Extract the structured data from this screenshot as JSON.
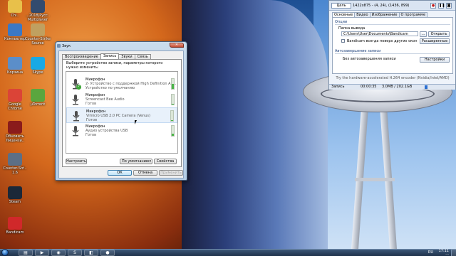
{
  "desktop": {
    "icons": [
      {
        "label": "Chi..",
        "icon": "folder-icon",
        "color": "#e8c04a"
      },
      {
        "label": "...2018|Русс.. Multiplayer",
        "icon": "game-icon",
        "color": "#334b6e"
      },
      {
        "label": "Компьютер",
        "icon": "computer-icon",
        "color": "#3b78c4"
      },
      {
        "label": "Counter-Strike Source",
        "icon": "cs-icon",
        "color": "#c0a060"
      },
      {
        "label": "Корзина",
        "icon": "recycle-bin-icon",
        "color": "#5b8ec9"
      },
      {
        "label": "Skype",
        "icon": "skype-icon",
        "color": "#19a9e5"
      },
      {
        "label": "Google Chrome",
        "icon": "chrome-icon",
        "color": "#db4437"
      },
      {
        "label": "µTorrent",
        "icon": "utorrent-icon",
        "color": "#5aa63e"
      },
      {
        "label": "Обновить Лицензи..",
        "icon": "update-icon",
        "color": "#8a1b1b"
      },
      {
        "label": "Counter-Stri.. 1.6",
        "icon": "cs16-icon",
        "color": "#5c6f86"
      },
      {
        "label": "Steam",
        "icon": "steam-icon",
        "color": "#1b2838"
      },
      {
        "label": "Bandicam",
        "icon": "bandicam-icon",
        "color": "#d0282a"
      }
    ]
  },
  "sound_dialog": {
    "title": "Звук",
    "close": "✕",
    "tabs": [
      "Воспроизведение",
      "Запись",
      "Звуки",
      "Связь"
    ],
    "active_tab": 1,
    "instruction": "Выберите устройство записи, параметры которого нужно изменить:",
    "devices": [
      {
        "name": "Микрофон",
        "desc": "2- Устройство с поддержкой High Definition Au...",
        "state": "Устройство по умолчанию",
        "level": 0.5,
        "default": true,
        "selected": false
      },
      {
        "name": "Микрофон",
        "desc": "Screencast Bee Audio",
        "state": "Готов",
        "level": 0.1,
        "default": false,
        "selected": false
      },
      {
        "name": "Микрофон",
        "desc": "Vimicro USB 2.0 PC Camera (Venus)",
        "state": "Готов",
        "level": 0.1,
        "default": false,
        "selected": true
      },
      {
        "name": "Микрофон",
        "desc": "Аудио устройства USB",
        "state": "Готов",
        "level": 0.25,
        "default": false,
        "selected": false
      }
    ],
    "btn_configure": "Настроить",
    "btn_default": "По умолчанию",
    "btn_properties": "Свойства",
    "btn_ok": "ОК",
    "btn_cancel": "Отмена",
    "btn_apply": "Применить"
  },
  "bandicam": {
    "target_label": "Цель",
    "resolution": "1422x875 - (4, 24), (1436, 899)",
    "ctrl_rec": "●",
    "ctrl_pause": "❚❚",
    "ctrl_cam": "◙",
    "tabs": [
      "Основные",
      "Видео",
      "Изображение",
      "О программе"
    ],
    "active_tab": 0,
    "section_options": "Опции",
    "output_label": "Папка вывода",
    "output_path": "C:\\Users\\User\\Documents\\Bandicam",
    "btn_browse": "...",
    "btn_open": "Открыть",
    "always_on_top": "Bandicam всегда поверх других окон",
    "btn_advanced": "Расширенные",
    "section_autocomplete": "Автозавершение записи",
    "autocomplete_value": "Без автозавершения записи",
    "btn_settings": "Настройки",
    "hint": "Try the hardware-accelerated H.264 encoder (Nvidia/Intel/AMD)",
    "status_label": "Запись",
    "status_time": "00:00:35",
    "status_size": "3.0MB / 202.1GB"
  },
  "taskbar": {
    "items": [
      {
        "icon": "explorer-icon",
        "glyph": "▤"
      },
      {
        "icon": "media-player-icon",
        "glyph": "▶"
      },
      {
        "icon": "firefox-icon",
        "glyph": "◉"
      },
      {
        "icon": "skype-icon",
        "glyph": "S"
      },
      {
        "icon": "screencast-icon",
        "glyph": "◧"
      },
      {
        "icon": "bandicam-icon",
        "glyph": "●"
      }
    ],
    "lang": "RU",
    "clock": "17:11",
    "date": "..."
  }
}
